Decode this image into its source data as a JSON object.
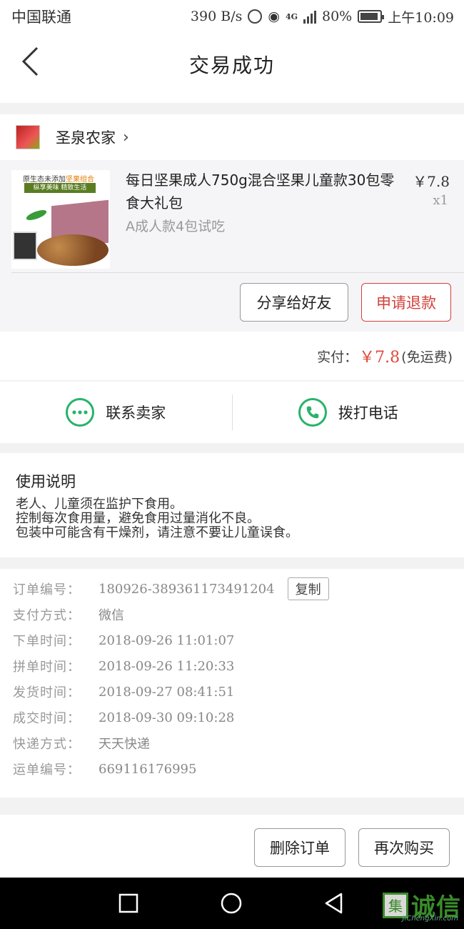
{
  "status_bar": {
    "carrier": "中国联通",
    "net_speed": "390 B/s",
    "network": "4G",
    "battery": "80%",
    "time": "上午10:09"
  },
  "nav": {
    "title": "交易成功"
  },
  "shop": {
    "name": "圣泉农家"
  },
  "product": {
    "image_text": {
      "line1": "原生态未添加",
      "line1_highlight": "坚果组合",
      "line2": "纵享美味 精致生活"
    },
    "title": "每日坚果成人750g混合坚果儿童款30包零食大礼包",
    "spec": "A成人款4包试吃",
    "price": "￥7.8",
    "quantity": "x1",
    "share_label": "分享给好友",
    "refund_label": "申请退款"
  },
  "payment": {
    "label": "实付：",
    "amount": "￥7.8",
    "note": "(免运费)"
  },
  "contact": {
    "seller_label": "联系卖家",
    "phone_label": "拨打电话"
  },
  "usage": {
    "heading": "使用说明",
    "lines": [
      "老人、儿童须在监护下食用。",
      "控制每次食用量，避免食用过量消化不良。",
      "包装中可能含有干燥剂，请注意不要让儿童误食。"
    ]
  },
  "order_info": {
    "copy_label": "复制",
    "rows": [
      {
        "label": "订单编号：",
        "value": "180926-389361173491204"
      },
      {
        "label": "支付方式：",
        "value": "微信"
      },
      {
        "label": "下单时间：",
        "value": "2018-09-26 11:01:07"
      },
      {
        "label": "拼单时间：",
        "value": "2018-09-26 11:20:33"
      },
      {
        "label": "发货时间：",
        "value": "2018-09-27 08:41:51"
      },
      {
        "label": "成交时间：",
        "value": "2018-09-30 09:10:28"
      },
      {
        "label": "快递方式：",
        "value": "天天快递"
      },
      {
        "label": "运单编号：",
        "value": "669116176995"
      }
    ]
  },
  "actions": {
    "delete_label": "删除订单",
    "rebuy_label": "再次购买"
  },
  "watermark": {
    "logo_char": "集",
    "text": "诚信",
    "sub": "JiChengXin.com"
  },
  "colors": {
    "accent_red": "#d4413a",
    "price_red": "#e0483a",
    "contact_green": "#28b36a"
  }
}
